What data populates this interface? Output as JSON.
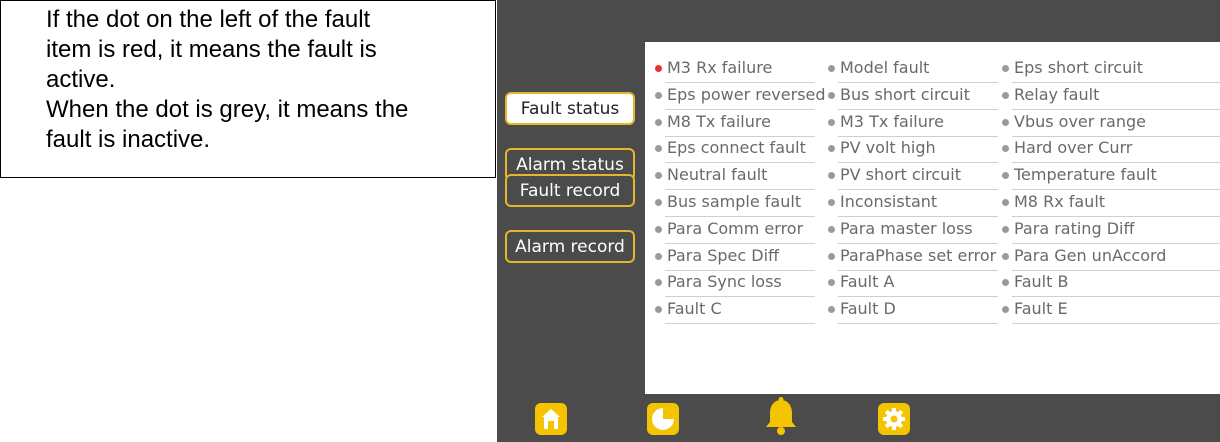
{
  "instruction": {
    "line1": "If the dot on the left of the fault",
    "line2": "item is red, it means the fault is",
    "line3": "active.",
    "line4": "When the dot is grey, it means the",
    "line5": "fault is inactive."
  },
  "sidebar": {
    "buttons": [
      {
        "label": "Fault status",
        "active": true
      },
      {
        "label": "Alarm status",
        "active": false
      },
      {
        "label": "Fault record",
        "active": false
      },
      {
        "label": "Alarm record",
        "active": false
      }
    ]
  },
  "faults": {
    "columns": [
      [
        {
          "label": "M3 Rx failure",
          "status": "active"
        },
        {
          "label": "Eps power reversed",
          "status": "inactive"
        },
        {
          "label": "M8 Tx failure",
          "status": "inactive"
        },
        {
          "label": "Eps connect fault",
          "status": "inactive"
        },
        {
          "label": "Neutral fault",
          "status": "inactive"
        },
        {
          "label": "Bus sample fault",
          "status": "inactive"
        },
        {
          "label": "Para Comm error",
          "status": "inactive"
        },
        {
          "label": "Para Spec Diff",
          "status": "inactive"
        },
        {
          "label": "Para Sync loss",
          "status": "inactive"
        },
        {
          "label": "Fault C",
          "status": "inactive"
        }
      ],
      [
        {
          "label": "Model fault",
          "status": "inactive"
        },
        {
          "label": "Bus short circuit",
          "status": "inactive"
        },
        {
          "label": "M3 Tx failure",
          "status": "inactive"
        },
        {
          "label": "PV volt high",
          "status": "inactive"
        },
        {
          "label": "PV short circuit",
          "status": "inactive"
        },
        {
          "label": "Inconsistant",
          "status": "inactive"
        },
        {
          "label": "Para master loss",
          "status": "inactive"
        },
        {
          "label": "ParaPhase set error",
          "status": "inactive"
        },
        {
          "label": "Fault A",
          "status": "inactive"
        },
        {
          "label": "Fault D",
          "status": "inactive"
        }
      ],
      [
        {
          "label": "Eps short circuit",
          "status": "inactive"
        },
        {
          "label": "Relay fault",
          "status": "inactive"
        },
        {
          "label": "Vbus over range",
          "status": "inactive"
        },
        {
          "label": "Hard over Curr",
          "status": "inactive"
        },
        {
          "label": "Temperature fault",
          "status": "inactive"
        },
        {
          "label": "M8 Rx fault",
          "status": "inactive"
        },
        {
          "label": "Para rating Diff",
          "status": "inactive"
        },
        {
          "label": "Para Gen unAccord",
          "status": "inactive"
        },
        {
          "label": "Fault B",
          "status": "inactive"
        },
        {
          "label": "Fault E",
          "status": "inactive"
        }
      ]
    ]
  },
  "nav": [
    {
      "icon": "home-icon"
    },
    {
      "icon": "pie-chart-icon"
    },
    {
      "icon": "bell-icon",
      "active": true
    },
    {
      "icon": "gear-icon"
    }
  ],
  "colors": {
    "active_dot": "#e53232",
    "inactive_dot": "#9a9a9a",
    "accent": "#f5c400",
    "button_border": "#e4b72a",
    "background": "#4b4b4b"
  }
}
